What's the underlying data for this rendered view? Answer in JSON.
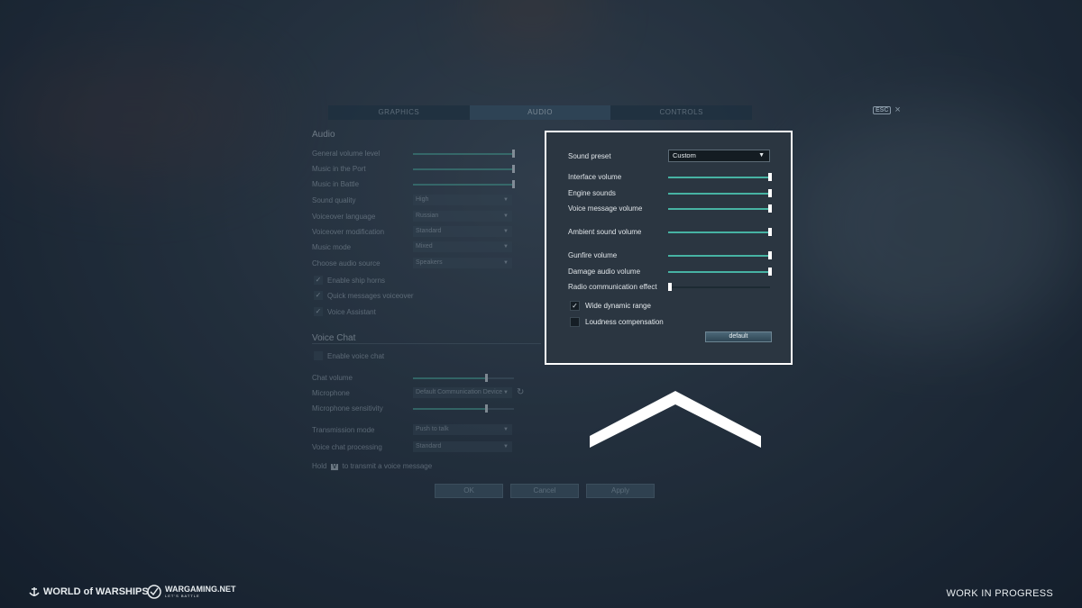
{
  "tabs": {
    "graphics": "GRAPHICS",
    "audio": "AUDIO",
    "controls": "CONTROLS"
  },
  "esc": {
    "key": "ESC",
    "close": "×"
  },
  "audio": {
    "title": "Audio",
    "general_volume": {
      "label": "General volume level",
      "value": 1.0
    },
    "music_port": {
      "label": "Music in the Port",
      "value": 1.0
    },
    "music_battle": {
      "label": "Music in Battle",
      "value": 1.0
    },
    "sound_quality": {
      "label": "Sound quality",
      "value": "High"
    },
    "voiceover_language": {
      "label": "Voiceover language",
      "value": "Russian"
    },
    "voiceover_modification": {
      "label": "Voiceover modification",
      "value": "Standard"
    },
    "music_mode": {
      "label": "Music mode",
      "value": "Mixed"
    },
    "audio_source": {
      "label": "Choose audio source",
      "value": "Speakers"
    },
    "ship_horns": {
      "label": "Enable ship horns",
      "checked": true
    },
    "quick_messages": {
      "label": "Quick messages voiceover",
      "checked": true
    },
    "voice_assistant": {
      "label": "Voice Assistant",
      "checked": true
    }
  },
  "voice_chat": {
    "title": "Voice Chat",
    "enable": {
      "label": "Enable voice chat",
      "checked": false
    },
    "chat_volume": {
      "label": "Chat volume",
      "value": 0.73
    },
    "microphone": {
      "label": "Microphone",
      "value": "Default Communication Device"
    },
    "mic_sensitivity": {
      "label": "Microphone sensitivity",
      "value": 0.73
    },
    "transmission_mode": {
      "label": "Transmission mode",
      "value": "Push to talk"
    },
    "processing": {
      "label": "Voice chat processing",
      "value": "Standard"
    },
    "hint_prefix": "Hold",
    "hint_key": "V",
    "hint_suffix": "to transmit a voice message"
  },
  "buttons": {
    "ok": "OK",
    "cancel": "Cancel",
    "apply": "Apply"
  },
  "panel": {
    "sound_preset": {
      "label": "Sound preset",
      "value": "Custom"
    },
    "interface_volume": {
      "label": "Interface volume",
      "value": 1.0
    },
    "engine_sounds": {
      "label": "Engine sounds",
      "value": 1.0
    },
    "voice_message_volume": {
      "label": "Voice message volume",
      "value": 1.0
    },
    "ambient_sound_volume": {
      "label": "Ambient sound volume",
      "value": 1.0
    },
    "gunfire_volume": {
      "label": "Gunfire volume",
      "value": 1.0
    },
    "damage_audio_volume": {
      "label": "Damage audio volume",
      "value": 1.0
    },
    "radio_effect": {
      "label": "Radio communication effect",
      "value": 0.0
    },
    "wide_dynamic_range": {
      "label": "Wide dynamic range",
      "checked": true
    },
    "loudness_compensation": {
      "label": "Loudness compensation",
      "checked": false
    },
    "default_button": "default"
  },
  "footer": {
    "wows_logo": "WORLD of WARSHIPS",
    "wg_logo": "WARGAMING.NET",
    "wg_tagline": "LET'S BATTLE",
    "work_in_progress": "WORK IN PROGRESS"
  },
  "colors": {
    "accent": "#47b3a3",
    "highlight_border": "#ffffff",
    "panel_bg": "#2b3641"
  },
  "icons": {
    "check": "checkmark-icon",
    "dropdown": "caret-down-icon",
    "refresh": "refresh-icon",
    "chevron": "chevron-up-icon"
  }
}
